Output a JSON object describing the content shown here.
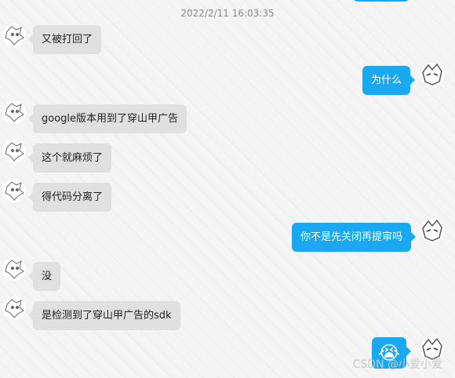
{
  "conversation": {
    "timestamp": "2022/2/11 16:03:35",
    "messages": [
      {
        "side": "left",
        "text": "又被打回了"
      },
      {
        "side": "right",
        "text": "为什么"
      },
      {
        "side": "left",
        "text": "google版本用到了穿山甲广告"
      },
      {
        "side": "left",
        "text": "这个就麻烦了"
      },
      {
        "side": "left",
        "text": "得代码分离了"
      },
      {
        "side": "right",
        "text": "你不是先关闭再提审吗"
      },
      {
        "side": "left",
        "text": "没"
      },
      {
        "side": "left",
        "text": "是检测到了穿山甲广告的sdk"
      },
      {
        "side": "right",
        "text": "😭",
        "type": "emoji"
      }
    ]
  },
  "watermark": "CSDN @小爱小爱",
  "colors": {
    "left_bubble": "#e0e0e0",
    "right_bubble": "#1aa8f0",
    "background": "#f4f4f4"
  }
}
